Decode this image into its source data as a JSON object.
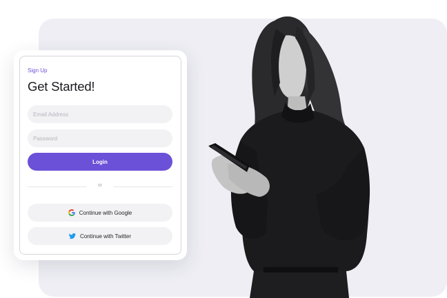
{
  "card": {
    "signup_label": "Sign Up",
    "title": "Get Started!"
  },
  "form": {
    "email_placeholder": "Email Address",
    "password_placeholder": "Password",
    "login_label": "Login",
    "divider_label": "or"
  },
  "social": {
    "google_label": "Continue with Google",
    "twitter_label": "Continue with Twitter",
    "google_icon": "google-icon",
    "twitter_icon": "twitter-icon"
  },
  "colors": {
    "accent": "#6b50d8",
    "backdrop": "#eeeef4",
    "twitter": "#1d9bf0"
  }
}
